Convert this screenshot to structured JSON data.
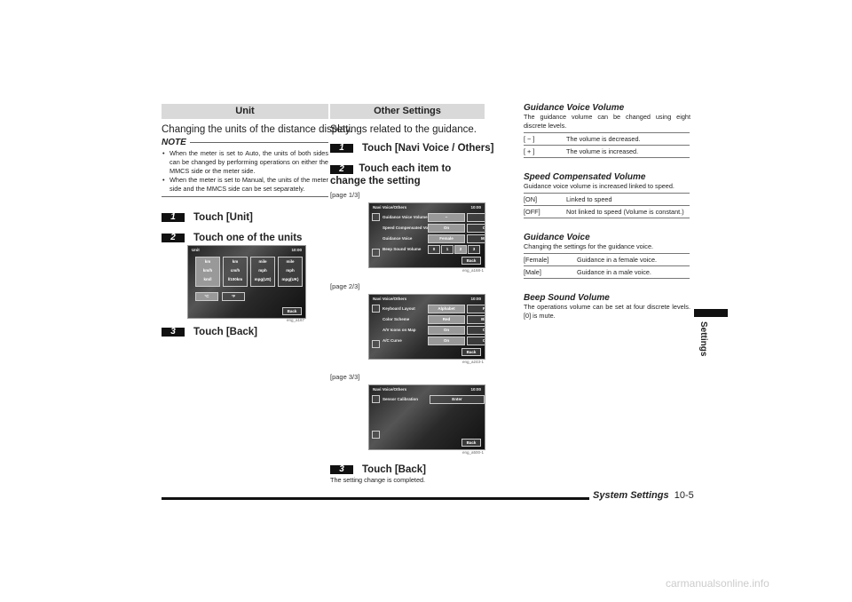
{
  "left": {
    "header": "Unit",
    "lead": "Changing the units of the distance display.",
    "note_title": "NOTE",
    "notes": [
      "When the meter is set to Auto, the units of both sides can be changed by performing operations on either the MMCS side or the meter side.",
      "When the meter is set to Manual, the units of the meter side and the MMCS side can be set separately."
    ],
    "steps": [
      {
        "n": "1",
        "text": "Touch [Unit]"
      },
      {
        "n": "2",
        "text": "Touch one of the units"
      },
      {
        "n": "3",
        "text": "Touch [Back]"
      }
    ],
    "screen": {
      "title": "Unit",
      "time": "10:00",
      "cols": [
        [
          "km",
          "km/h",
          "km/l"
        ],
        [
          "km",
          "cm/h",
          "l/100km"
        ],
        [
          "mile",
          "mph",
          "mpg(US)"
        ],
        [
          "mile",
          "mph",
          "mpg(UK)"
        ]
      ],
      "temp": [
        "°C",
        "°F"
      ],
      "back": "Back",
      "caption": "eng_a167"
    }
  },
  "middle": {
    "header": "Other Settings",
    "lead": "Settings related to the guidance.",
    "steps": [
      {
        "n": "1",
        "text": "Touch [Navi Voice / Others]"
      },
      {
        "n": "2",
        "text": "Touch each item to change the setting"
      },
      {
        "n": "3",
        "text": "Touch [Back]"
      }
    ],
    "step3_desc": "The setting change is completed.",
    "pages": [
      {
        "label": "[page 1/3]",
        "caption": "eng_a168-1",
        "rows": [
          {
            "name": "Guidance Voice Volume",
            "opts": [
              "−",
              "+"
            ]
          },
          {
            "name": "Speed Compensated Volume",
            "opts": [
              "On",
              "Off"
            ]
          },
          {
            "name": "Guidance Voice",
            "opts": [
              "Female",
              "Male"
            ]
          },
          {
            "name": "Beep Sound Volume",
            "opts": [
              "0",
              "1",
              "2",
              "3"
            ]
          }
        ]
      },
      {
        "label": "[page 2/3]",
        "caption": "eng_a243-1",
        "rows": [
          {
            "name": "Keyboard Layout",
            "opts": [
              "Alphabet",
              "PC"
            ]
          },
          {
            "name": "Color Scheme",
            "opts": [
              "Red",
              "Blue"
            ]
          },
          {
            "name": "A/V Icons on Map",
            "opts": [
              "On",
              "Off"
            ]
          },
          {
            "name": "A/C Curve",
            "opts": [
              "On",
              "Off"
            ]
          }
        ]
      },
      {
        "label": "[page 3/3]",
        "caption": "eng_a500-1",
        "rows": [
          {
            "name": "Sensor Calibration",
            "opts": [
              "Enter"
            ]
          }
        ]
      }
    ],
    "screen_title": "Navi Voice/Others",
    "screen_time": "10:00",
    "back": "Back"
  },
  "right": {
    "sections": [
      {
        "title": "Guidance Voice Volume",
        "desc": "The guidance volume can be changed using eight discrete levels.",
        "rows": [
          [
            "[ − ]",
            "The volume is decreased."
          ],
          [
            "[ + ]",
            "The volume is increased."
          ]
        ]
      },
      {
        "title": "Speed Compensated Volume",
        "desc": "Guidance voice volume is increased linked to speed.",
        "rows": [
          [
            "[ON]",
            "Linked to speed"
          ],
          [
            "[OFF]",
            "Not linked to speed (Volume is constant.)"
          ]
        ]
      },
      {
        "title": "Guidance Voice",
        "desc": "Changing the settings for the guidance voice.",
        "rows": [
          [
            "[Female]",
            "Guidance in a female voice."
          ],
          [
            "[Male]",
            "Guidance in a male voice."
          ]
        ]
      },
      {
        "title": "Beep Sound Volume",
        "desc": "The operations volume can be set at four discrete levels. [0] is mute.",
        "rows": []
      }
    ]
  },
  "side_tab": "Settings",
  "footer": {
    "title": "System Settings",
    "page": "10-5"
  },
  "watermark": "carmanualsonline.info"
}
